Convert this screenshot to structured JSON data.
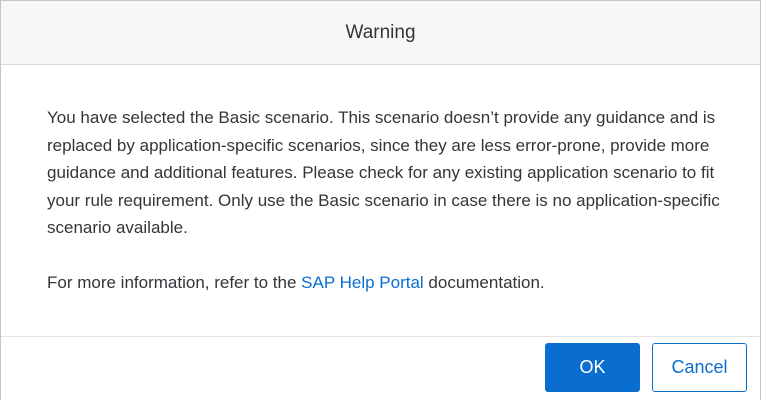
{
  "dialog": {
    "title": "Warning",
    "message": {
      "paragraph1": "You have selected the Basic scenario. This scenario doesn’t provide any guidance and is replaced by application-specific scenarios, since they are less error-prone, provide more guidance and additional features. Please check for any existing application scenario to fit your rule requirement. Only use the Basic scenario in case there is no application-specific scenario available.",
      "paragraph2_before": "For more information, refer to the ",
      "paragraph2_link": "SAP Help Portal",
      "paragraph2_after": " documentation."
    },
    "buttons": {
      "ok_label": "OK",
      "cancel_label": "Cancel"
    },
    "colors": {
      "accent": "#0a6ed1",
      "text": "#32363a",
      "header_bg": "#f7f7f7"
    }
  }
}
